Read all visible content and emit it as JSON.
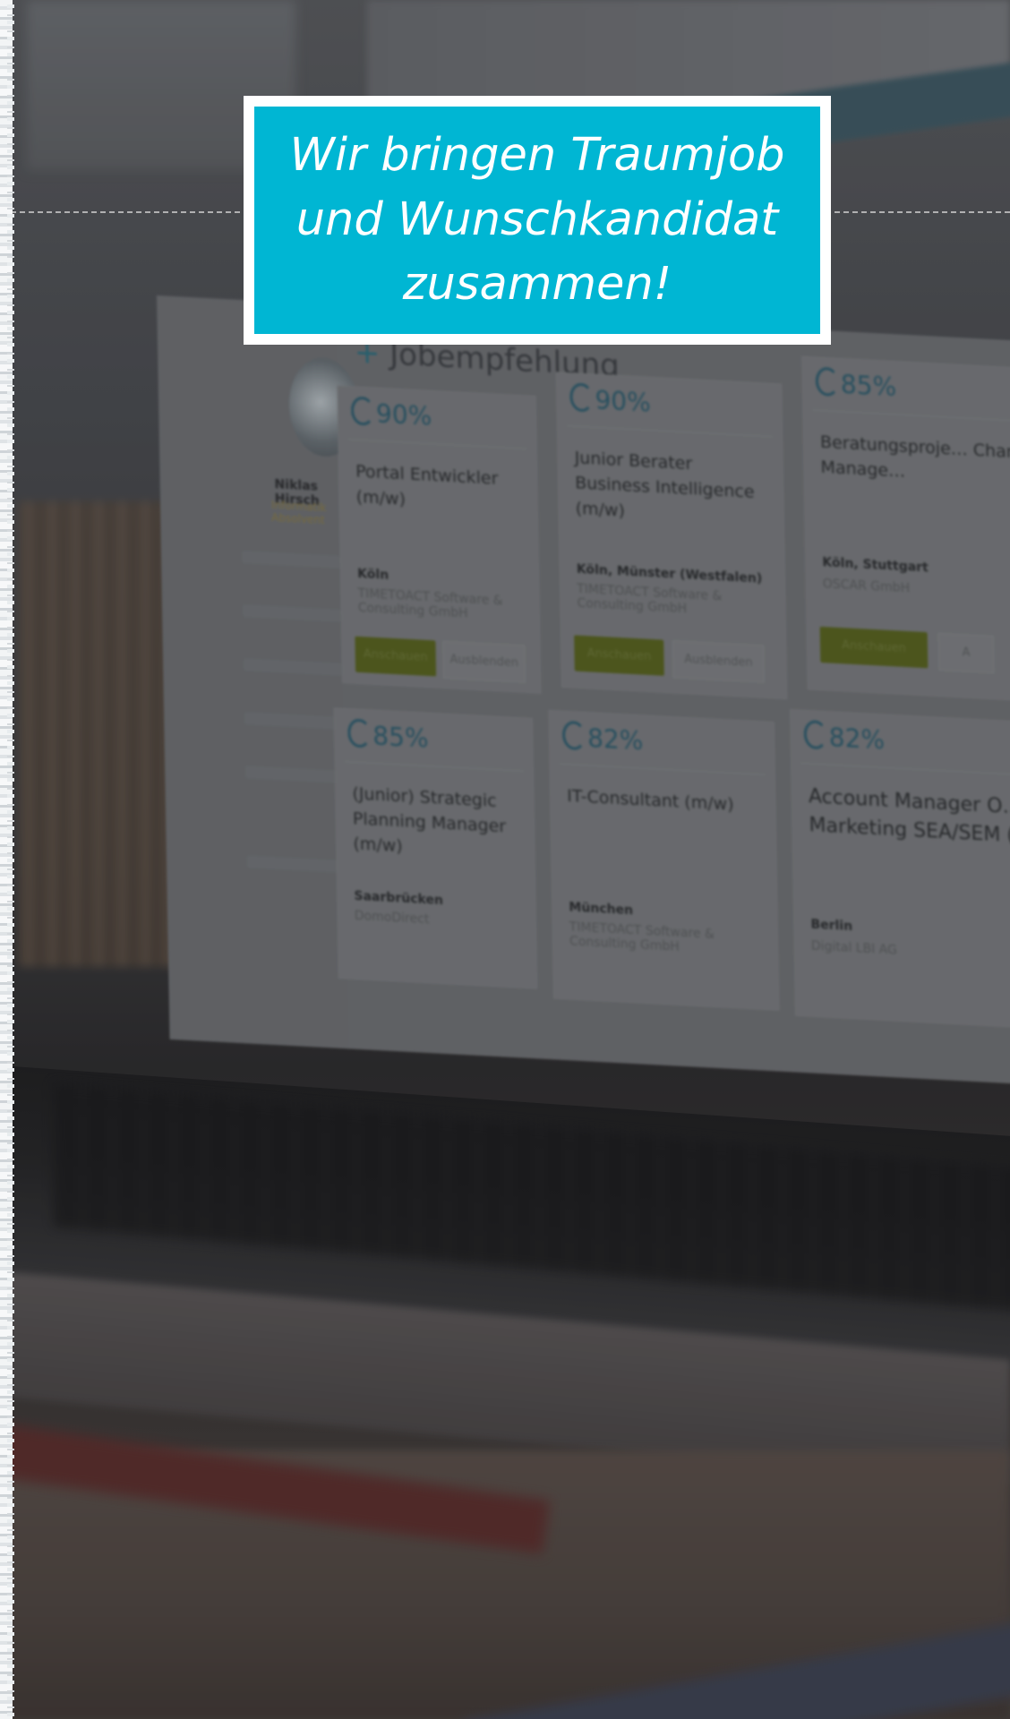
{
  "banner": {
    "lines": [
      "Wir bringen Traumjob",
      "und Wunschkandidat",
      "zusammen!"
    ]
  },
  "screen": {
    "section_title": "Jobempfehlung",
    "user": {
      "name": "Niklas Hirsch",
      "role": "Informatik Absolvent"
    },
    "cards": [
      {
        "match": "90%",
        "title": "Portal Entwickler (m/w)",
        "location": "Köln",
        "company": "TIMETOACT Software & Consulting GmbH",
        "primary_label": "Anschauen",
        "secondary_label": "Ausblenden"
      },
      {
        "match": "90%",
        "title": "Junior Berater Business Intelligence (m/w)",
        "location": "Köln, Münster (Westfalen)",
        "company": "TIMETOACT Software & Consulting GmbH",
        "primary_label": "Anschauen",
        "secondary_label": "Ausblenden"
      },
      {
        "match": "85%",
        "title": "Beratungsproje… Change Manage…",
        "location": "Köln, Stuttgart",
        "company": "OSCAR GmbH",
        "primary_label": "Anschauen",
        "secondary_label": "A"
      },
      {
        "match": "85%",
        "title": "(Junior) Strategic Planning Manager (m/w)",
        "location": "Saarbrücken",
        "company": "DomoDirect",
        "primary_label": "",
        "secondary_label": ""
      },
      {
        "match": "82%",
        "title": "IT-Consultant (m/w)",
        "location": "München",
        "company": "TIMETOACT Software & Consulting GmbH",
        "primary_label": "",
        "secondary_label": ""
      },
      {
        "match": "82%",
        "title": "Account Manager O… Marketing SEA/SEM (…",
        "location": "Berlin",
        "company": "Digital LBI AG",
        "primary_label": "",
        "secondary_label": ""
      }
    ]
  },
  "colors": {
    "banner_bg": "#00b6d3",
    "banner_border": "#ffffff",
    "banner_text": "#ffffff"
  }
}
